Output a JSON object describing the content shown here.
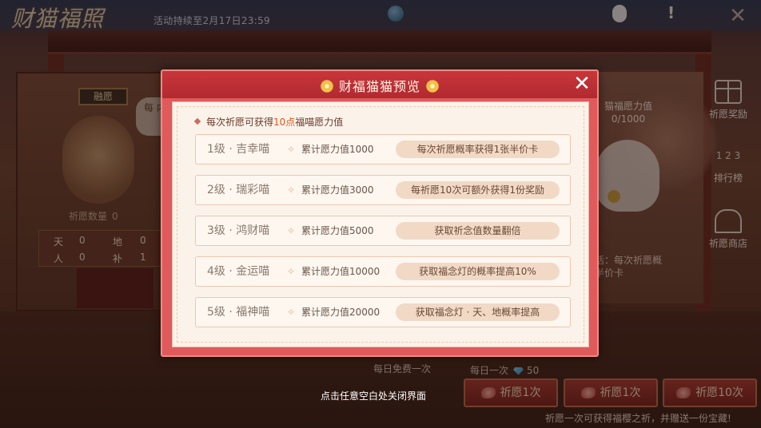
{
  "topbar": {
    "logo": "财猫福照",
    "event_time": "活动持续至2月17日23:59"
  },
  "background": {
    "shrine_title": "融愿",
    "bubble_text": "每 内",
    "count_label": "祈愿数量",
    "count_value": "0",
    "fates": [
      {
        "label": "天",
        "value": "0"
      },
      {
        "label": "地",
        "value": "0"
      },
      {
        "label": "人",
        "value": "0"
      },
      {
        "label": "补",
        "value": "1"
      }
    ],
    "wish_power_title": "猫福愿力值",
    "wish_power_value": "0/1000",
    "right_note_line1": "活：每次祈愿概",
    "right_note_line2": "半价卡"
  },
  "side_menu": [
    {
      "label": "祈愿奖励",
      "icon": "gift-icon"
    },
    {
      "label": "排行榜",
      "icon": "ranking-icon",
      "glyph": "1 2 3"
    },
    {
      "label": "祈愿商店",
      "icon": "shop-icon"
    }
  ],
  "bottom": {
    "daily_free": "每日免费一次",
    "daily_once": "每日一次",
    "gem_cost": "50",
    "buttons": [
      {
        "label": "祈愿1次"
      },
      {
        "label": "祈愿1次"
      },
      {
        "label": "祈愿10次"
      }
    ],
    "hint": "祈愿一次可获得福樱之祈，并赠送一份宝藏!",
    "close_hint": "点击任意空白处关闭界面"
  },
  "modal": {
    "title": "财福猫猫预览",
    "intro_prefix": "每次祈愿可获得",
    "intro_highlight": "10点",
    "intro_suffix": "福喵愿力值",
    "levels": [
      {
        "name": "1级 · 吉幸喵",
        "value": "累计愿力值1000",
        "reward": "每次祈愿概率获得1张半价卡"
      },
      {
        "name": "2级 · 瑞彩喵",
        "value": "累计愿力值3000",
        "reward": "每祈愿10次可额外获得1份奖励"
      },
      {
        "name": "3级 · 鸿财喵",
        "value": "累计愿力值5000",
        "reward": "获取祈念值数量翻倍"
      },
      {
        "name": "4级 · 金运喵",
        "value": "累计愿力值10000",
        "reward": "获取福念灯的概率提高10%"
      },
      {
        "name": "5级 · 福神喵",
        "value": "累计愿力值20000",
        "reward": "获取福念灯 · 天、地概率提高"
      }
    ]
  }
}
